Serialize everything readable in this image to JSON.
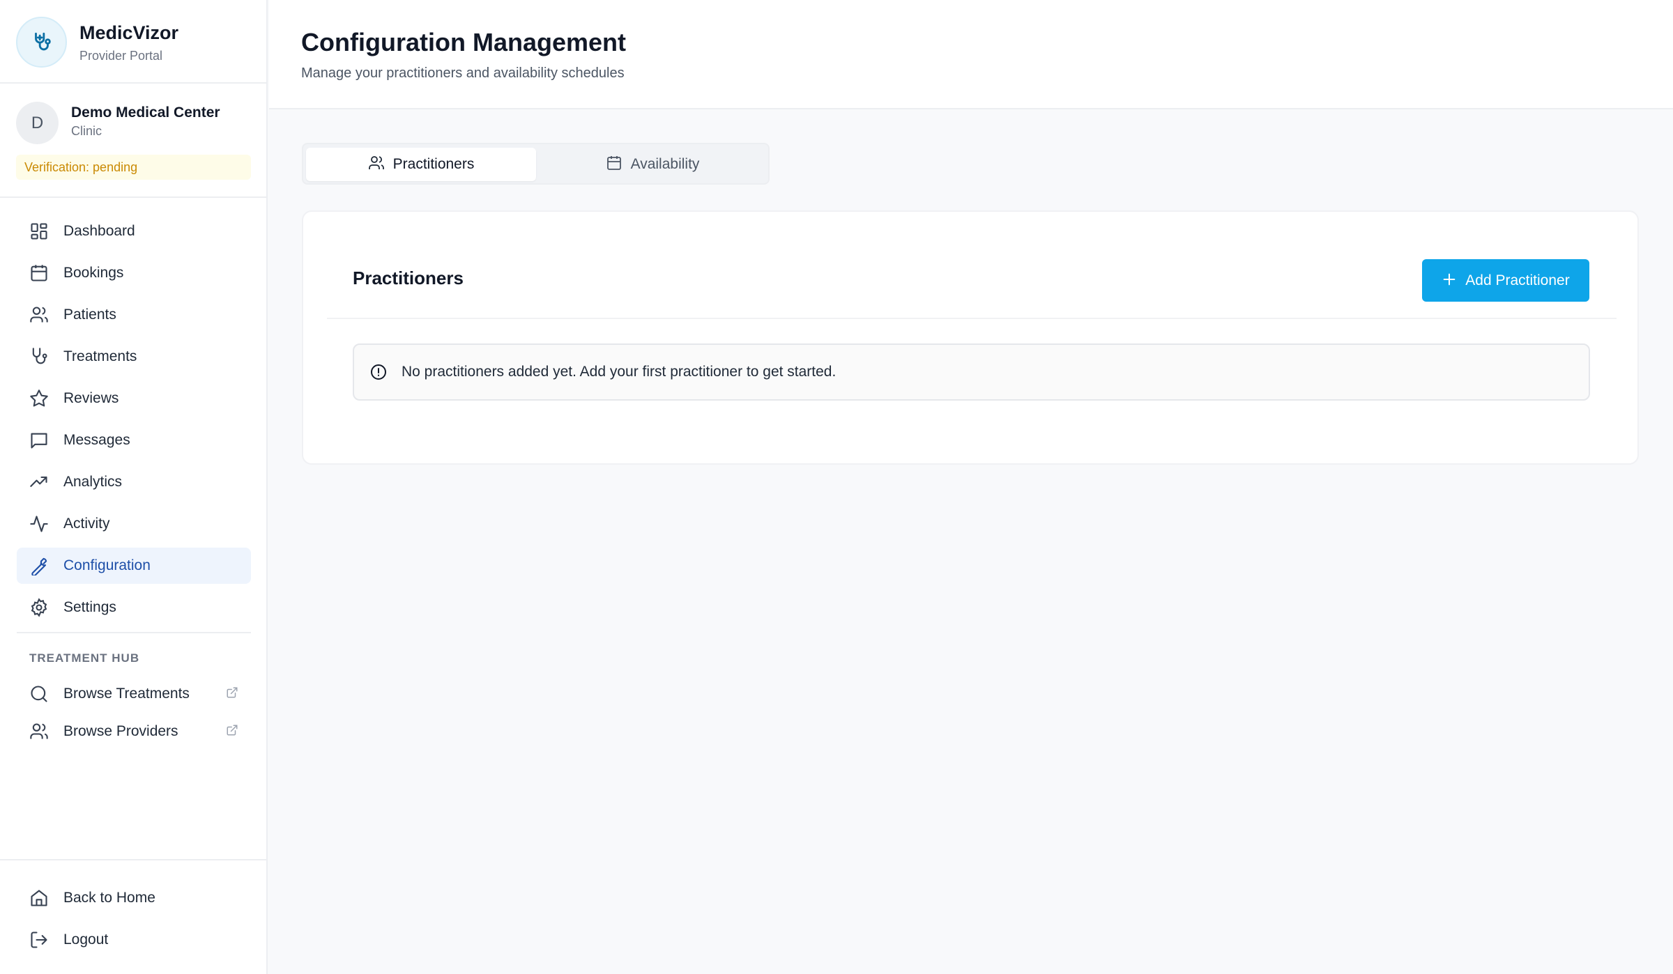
{
  "brand": {
    "name": "MedicVizor",
    "subtitle": "Provider Portal"
  },
  "organization": {
    "initial": "D",
    "name": "Demo Medical Center",
    "type": "Clinic",
    "verification": "Verification: pending"
  },
  "nav": {
    "items": [
      {
        "label": "Dashboard",
        "icon": "dashboard-icon"
      },
      {
        "label": "Bookings",
        "icon": "calendar-icon"
      },
      {
        "label": "Patients",
        "icon": "users-icon"
      },
      {
        "label": "Treatments",
        "icon": "stethoscope-icon"
      },
      {
        "label": "Reviews",
        "icon": "star-icon"
      },
      {
        "label": "Messages",
        "icon": "message-icon"
      },
      {
        "label": "Analytics",
        "icon": "trending-up-icon"
      },
      {
        "label": "Activity",
        "icon": "activity-icon"
      },
      {
        "label": "Configuration",
        "icon": "wrench-icon",
        "active": true
      },
      {
        "label": "Settings",
        "icon": "gear-icon"
      }
    ],
    "hub_title": "TREATMENT HUB",
    "hub_items": [
      {
        "label": "Browse Treatments",
        "icon": "search-icon"
      },
      {
        "label": "Browse Providers",
        "icon": "users-icon"
      }
    ],
    "bottom_items": [
      {
        "label": "Back to Home",
        "icon": "home-icon"
      },
      {
        "label": "Logout",
        "icon": "logout-icon"
      }
    ]
  },
  "header": {
    "title": "Configuration Management",
    "subtitle": "Manage your practitioners and availability schedules"
  },
  "tabs": [
    {
      "label": "Practitioners",
      "active": true
    },
    {
      "label": "Availability",
      "active": false
    }
  ],
  "card": {
    "title": "Practitioners",
    "add_button": "Add Practitioner",
    "empty_message": "No practitioners added yet. Add your first practitioner to get started."
  },
  "colors": {
    "accent": "#0ea5e9",
    "active_nav_bg": "#eef4fd",
    "active_nav_text": "#1e4fa8",
    "warning_text": "#ca8a04"
  }
}
